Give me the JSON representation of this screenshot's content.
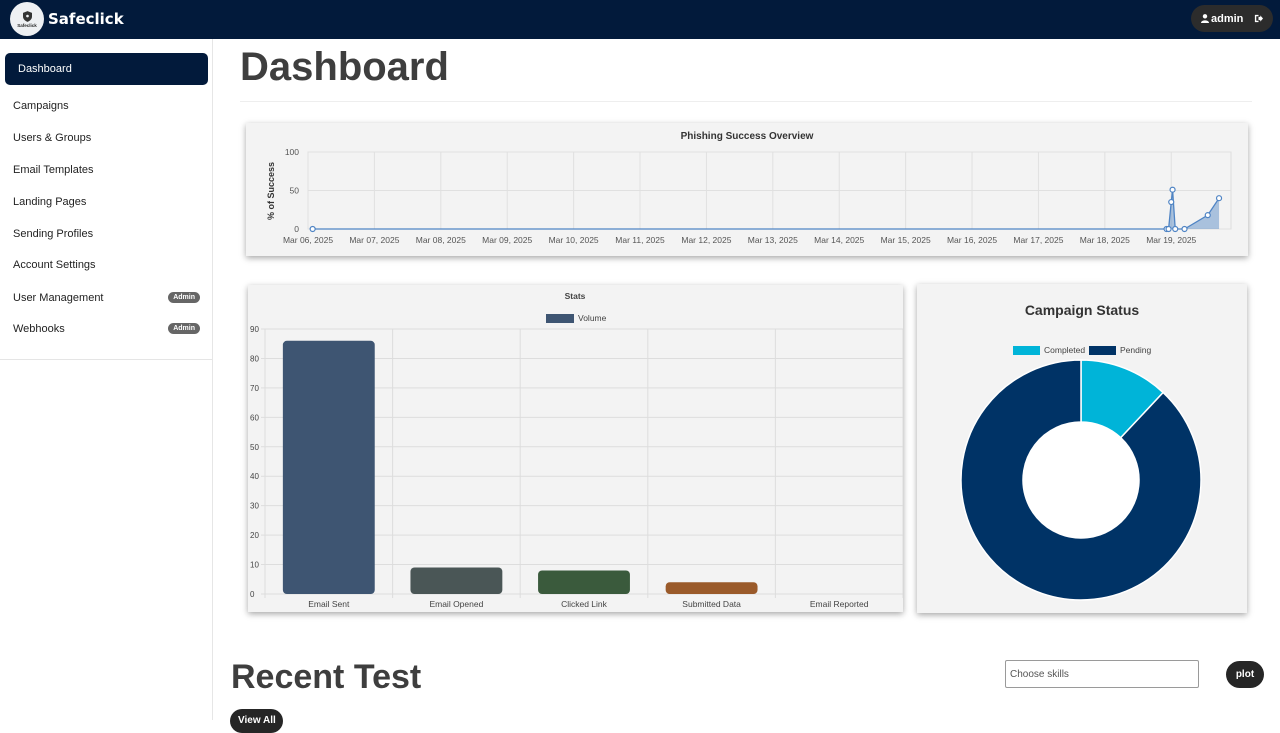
{
  "brand": {
    "logo_text": "Safeclick",
    "name": "Safeclick"
  },
  "user": {
    "name": "admin"
  },
  "sidebar": {
    "items": [
      {
        "label": "Dashboard",
        "active": true
      },
      {
        "label": "Campaigns"
      },
      {
        "label": "Users & Groups"
      },
      {
        "label": "Email Templates"
      },
      {
        "label": "Landing Pages"
      },
      {
        "label": "Sending Profiles"
      },
      {
        "label": "Account Settings"
      },
      {
        "label": "User Management",
        "badge": "Admin"
      },
      {
        "label": "Webhooks",
        "badge": "Admin"
      }
    ]
  },
  "main": {
    "title": "Dashboard",
    "recent_title": "Recent Test",
    "skills_placeholder": "Choose skills",
    "plot_label": "plot",
    "bottom_pill_label": "View All"
  },
  "colors": {
    "navy": "#021a3b",
    "line_series": "#4f84c4",
    "completed": "#00b4d8",
    "pending": "#003366"
  },
  "chart_data": [
    {
      "type": "line",
      "title": "Phishing Success Overview",
      "ylabel": "% of Success",
      "xlabel": "",
      "x_ticks": [
        "Mar 06, 2025",
        "Mar 07, 2025",
        "Mar 08, 2025",
        "Mar 09, 2025",
        "Mar 10, 2025",
        "Mar 11, 2025",
        "Mar 12, 2025",
        "Mar 13, 2025",
        "Mar 14, 2025",
        "Mar 15, 2025",
        "Mar 16, 2025",
        "Mar 17, 2025",
        "Mar 18, 2025",
        "Mar 19, 2025"
      ],
      "y_ticks": [
        0,
        50,
        100
      ],
      "ylim": [
        0,
        100
      ],
      "grid": true,
      "series": [
        {
          "x": [
            0.07,
            12.93,
            12.96,
            13.0,
            13.02,
            13.06,
            13.2,
            13.55,
            13.72
          ],
          "values": [
            0,
            0,
            0,
            35,
            51,
            0,
            0,
            18,
            40
          ]
        }
      ]
    },
    {
      "type": "bar",
      "title": "Stats",
      "legend": [
        "Volume"
      ],
      "legend_position": "top",
      "categories": [
        "Email Sent",
        "Email Opened",
        "Clicked Link",
        "Submitted Data",
        "Email Reported"
      ],
      "values": [
        86,
        9,
        8,
        4,
        0
      ],
      "colors": [
        "#3e5572",
        "#4a5656",
        "#3a5a3c",
        "#9a5a2a",
        "#777777"
      ],
      "y_ticks": [
        0,
        10,
        20,
        30,
        40,
        50,
        60,
        70,
        80,
        90
      ],
      "ylim": [
        0,
        90
      ],
      "grid": true
    },
    {
      "type": "pie",
      "title": "Campaign Status",
      "legend": [
        "Completed",
        "Pending"
      ],
      "legend_position": "top",
      "values": [
        12,
        88
      ],
      "colors": [
        "#00b4d8",
        "#003366"
      ]
    }
  ]
}
